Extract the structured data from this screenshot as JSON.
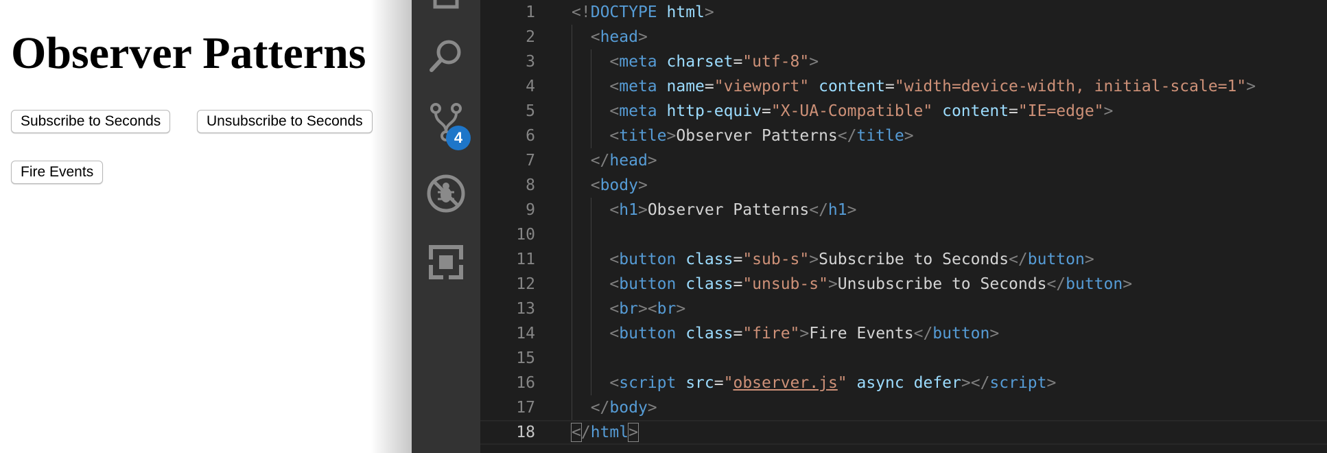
{
  "preview": {
    "heading": "Observer Patterns",
    "buttons": {
      "subscribe": "Subscribe to Seconds",
      "unsubscribe": "Unsubscribe to Seconds",
      "fire": "Fire Events"
    }
  },
  "activity_bar": {
    "items": [
      {
        "icon": "files-icon"
      },
      {
        "icon": "search-icon"
      },
      {
        "icon": "source-control-icon"
      },
      {
        "icon": "debug-icon"
      },
      {
        "icon": "extensions-icon"
      }
    ],
    "source_control_badge": "4"
  },
  "editor": {
    "current_line": 18,
    "lines": [
      {
        "n": "1",
        "tokens": [
          [
            "br",
            "<"
          ],
          [
            "br",
            "!"
          ],
          [
            "tag",
            "DOCTYPE"
          ],
          [
            "txt",
            " "
          ],
          [
            "attr",
            "html"
          ],
          [
            "br",
            ">"
          ]
        ]
      },
      {
        "n": "2",
        "tokens": [
          [
            "txt",
            "  "
          ],
          [
            "br",
            "<"
          ],
          [
            "tag",
            "head"
          ],
          [
            "br",
            ">"
          ]
        ]
      },
      {
        "n": "3",
        "tokens": [
          [
            "txt",
            "    "
          ],
          [
            "br",
            "<"
          ],
          [
            "tag",
            "meta"
          ],
          [
            "txt",
            " "
          ],
          [
            "attr",
            "charset"
          ],
          [
            "txt",
            "="
          ],
          [
            "str",
            "\"utf-8\""
          ],
          [
            "br",
            ">"
          ]
        ]
      },
      {
        "n": "4",
        "tokens": [
          [
            "txt",
            "    "
          ],
          [
            "br",
            "<"
          ],
          [
            "tag",
            "meta"
          ],
          [
            "txt",
            " "
          ],
          [
            "attr",
            "name"
          ],
          [
            "txt",
            "="
          ],
          [
            "str",
            "\"viewport\""
          ],
          [
            "txt",
            " "
          ],
          [
            "attr",
            "content"
          ],
          [
            "txt",
            "="
          ],
          [
            "str",
            "\"width=device-width, initial-scale=1\""
          ],
          [
            "br",
            ">"
          ]
        ]
      },
      {
        "n": "5",
        "tokens": [
          [
            "txt",
            "    "
          ],
          [
            "br",
            "<"
          ],
          [
            "tag",
            "meta"
          ],
          [
            "txt",
            " "
          ],
          [
            "attr",
            "http-equiv"
          ],
          [
            "txt",
            "="
          ],
          [
            "str",
            "\"X-UA-Compatible\""
          ],
          [
            "txt",
            " "
          ],
          [
            "attr",
            "content"
          ],
          [
            "txt",
            "="
          ],
          [
            "str",
            "\"IE=edge\""
          ],
          [
            "br",
            ">"
          ]
        ]
      },
      {
        "n": "6",
        "tokens": [
          [
            "txt",
            "    "
          ],
          [
            "br",
            "<"
          ],
          [
            "tag",
            "title"
          ],
          [
            "br",
            ">"
          ],
          [
            "txt",
            "Observer Patterns"
          ],
          [
            "br",
            "</"
          ],
          [
            "tag",
            "title"
          ],
          [
            "br",
            ">"
          ]
        ]
      },
      {
        "n": "7",
        "tokens": [
          [
            "txt",
            "  "
          ],
          [
            "br",
            "</"
          ],
          [
            "tag",
            "head"
          ],
          [
            "br",
            ">"
          ]
        ]
      },
      {
        "n": "8",
        "tokens": [
          [
            "txt",
            "  "
          ],
          [
            "br",
            "<"
          ],
          [
            "tag",
            "body"
          ],
          [
            "br",
            ">"
          ]
        ]
      },
      {
        "n": "9",
        "tokens": [
          [
            "txt",
            "    "
          ],
          [
            "br",
            "<"
          ],
          [
            "tag",
            "h1"
          ],
          [
            "br",
            ">"
          ],
          [
            "txt",
            "Observer Patterns"
          ],
          [
            "br",
            "</"
          ],
          [
            "tag",
            "h1"
          ],
          [
            "br",
            ">"
          ]
        ]
      },
      {
        "n": "10",
        "tokens": []
      },
      {
        "n": "11",
        "tokens": [
          [
            "txt",
            "    "
          ],
          [
            "br",
            "<"
          ],
          [
            "tag",
            "button"
          ],
          [
            "txt",
            " "
          ],
          [
            "attr",
            "class"
          ],
          [
            "txt",
            "="
          ],
          [
            "str",
            "\"sub-s\""
          ],
          [
            "br",
            ">"
          ],
          [
            "txt",
            "Subscribe to Seconds"
          ],
          [
            "br",
            "</"
          ],
          [
            "tag",
            "button"
          ],
          [
            "br",
            ">"
          ]
        ]
      },
      {
        "n": "12",
        "tokens": [
          [
            "txt",
            "    "
          ],
          [
            "br",
            "<"
          ],
          [
            "tag",
            "button"
          ],
          [
            "txt",
            " "
          ],
          [
            "attr",
            "class"
          ],
          [
            "txt",
            "="
          ],
          [
            "str",
            "\"unsub-s\""
          ],
          [
            "br",
            ">"
          ],
          [
            "txt",
            "Unsubscribe to Seconds"
          ],
          [
            "br",
            "</"
          ],
          [
            "tag",
            "button"
          ],
          [
            "br",
            ">"
          ]
        ]
      },
      {
        "n": "13",
        "tokens": [
          [
            "txt",
            "    "
          ],
          [
            "br",
            "<"
          ],
          [
            "tag",
            "br"
          ],
          [
            "br",
            "><"
          ],
          [
            "tag",
            "br"
          ],
          [
            "br",
            ">"
          ]
        ]
      },
      {
        "n": "14",
        "tokens": [
          [
            "txt",
            "    "
          ],
          [
            "br",
            "<"
          ],
          [
            "tag",
            "button"
          ],
          [
            "txt",
            " "
          ],
          [
            "attr",
            "class"
          ],
          [
            "txt",
            "="
          ],
          [
            "str",
            "\"fire\""
          ],
          [
            "br",
            ">"
          ],
          [
            "txt",
            "Fire Events"
          ],
          [
            "br",
            "</"
          ],
          [
            "tag",
            "button"
          ],
          [
            "br",
            ">"
          ]
        ]
      },
      {
        "n": "15",
        "tokens": []
      },
      {
        "n": "16",
        "tokens": [
          [
            "txt",
            "    "
          ],
          [
            "br",
            "<"
          ],
          [
            "tag",
            "script"
          ],
          [
            "txt",
            " "
          ],
          [
            "attr",
            "src"
          ],
          [
            "txt",
            "="
          ],
          [
            "str",
            "\""
          ],
          [
            "link",
            "observer.js"
          ],
          [
            "str",
            "\""
          ],
          [
            "txt",
            " "
          ],
          [
            "attr",
            "async"
          ],
          [
            "txt",
            " "
          ],
          [
            "attr",
            "defer"
          ],
          [
            "br",
            "></"
          ],
          [
            "tag",
            "script"
          ],
          [
            "br",
            ">"
          ]
        ]
      },
      {
        "n": "17",
        "tokens": [
          [
            "txt",
            "  "
          ],
          [
            "br",
            "</"
          ],
          [
            "tag",
            "body"
          ],
          [
            "br",
            ">"
          ]
        ]
      },
      {
        "n": "18",
        "tokens": [
          [
            "hl",
            "<"
          ],
          [
            "br",
            "/"
          ],
          [
            "tag",
            "html"
          ],
          [
            "hl",
            ">"
          ]
        ]
      }
    ]
  }
}
